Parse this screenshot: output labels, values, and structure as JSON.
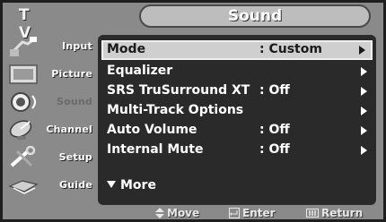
{
  "header": {
    "source_label": "T V",
    "title": "Sound"
  },
  "sidebar": {
    "items": [
      {
        "label": "Input",
        "icon": "input-plug-icon"
      },
      {
        "label": "Picture",
        "icon": "picture-icon"
      },
      {
        "label": "Sound",
        "icon": "speaker-icon",
        "active": true
      },
      {
        "label": "Channel",
        "icon": "satellite-dish-icon"
      },
      {
        "label": "Setup",
        "icon": "setup-tools-icon"
      },
      {
        "label": "Guide",
        "icon": "guide-icon"
      }
    ]
  },
  "menu": {
    "items": [
      {
        "label": "Mode",
        "value": ": Custom",
        "selected": true
      },
      {
        "label": "Equalizer",
        "value": ""
      },
      {
        "label": "SRS TruSurround XT",
        "value": ": Off"
      },
      {
        "label": "Multi-Track Options",
        "value": ""
      },
      {
        "label": "Auto Volume",
        "value": ": Off"
      },
      {
        "label": "Internal Mute",
        "value": ": Off"
      }
    ],
    "more_label": "More"
  },
  "footer": {
    "move": "Move",
    "enter": "Enter",
    "return": "Return"
  },
  "colors": {
    "background": "#8a8a8a",
    "panel": "#2a2a2a",
    "selected_row": "#cfcfcf"
  }
}
